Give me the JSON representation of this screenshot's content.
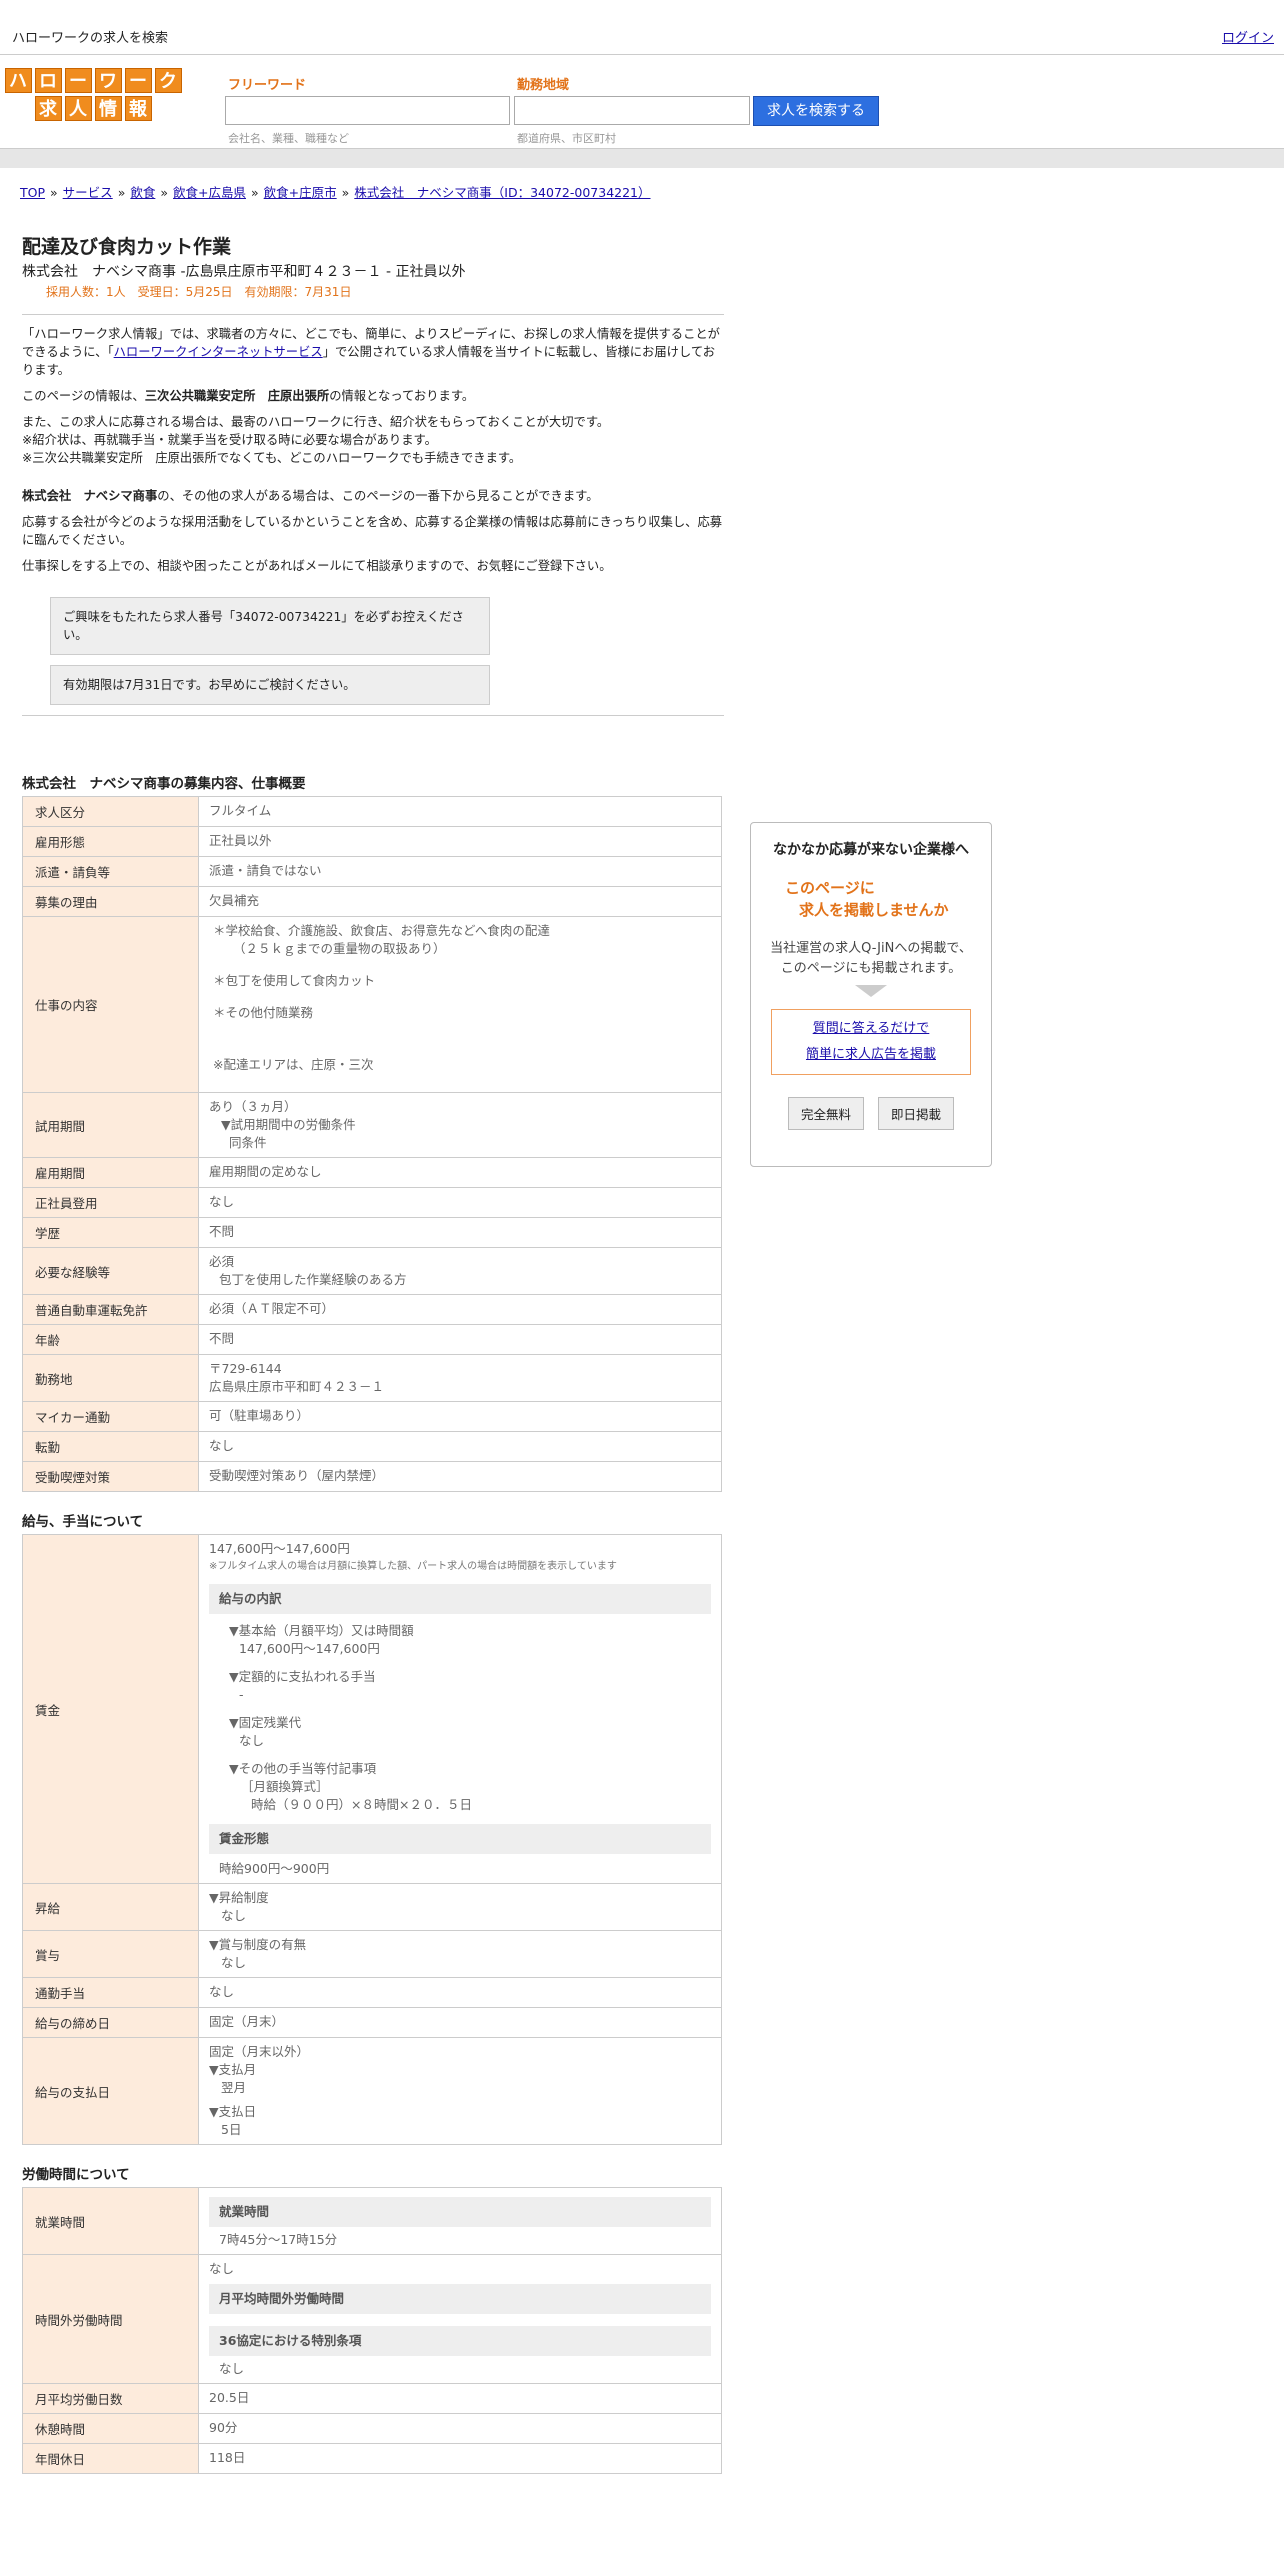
{
  "topbar": {
    "title": "ハローワークの求人を検索",
    "login": "ログイン"
  },
  "logo": {
    "row1": [
      "ハ",
      "ロ",
      "ー",
      "ワ",
      "ー",
      "ク"
    ],
    "row2": [
      "求",
      "人",
      "情",
      "報"
    ]
  },
  "search": {
    "freeword_label": "フリーワード",
    "freeword_hint": "会社名、業種、職種など",
    "area_label": "勤務地域",
    "area_hint": "都道府県、市区町村",
    "button": "求人を検索する"
  },
  "breadcrumb": [
    "TOP",
    "サービス",
    "飲食",
    "飲食+広島県",
    "飲食+庄原市",
    "株式会社　ナベシマ商事（ID：34072-00734221）"
  ],
  "job": {
    "title": "配達及び食肉カット作業",
    "subtitle": "株式会社　ナベシマ商事 -広島県庄原市平和町４２３－１ - 正社員以外",
    "meta": "採用人数：1人　受理日：5月25日　有効期限：7月31日"
  },
  "intro": {
    "p1a": "「ハローワーク求人情報」では、求職者の方々に、どこでも、簡単に、よりスピーディに、お探しの求人情報を提供することができるように、「",
    "p1link": "ハローワークインターネットサービス",
    "p1b": "」で公開されている求人情報を当サイトに転載し、皆様にお届けしております。",
    "p2a": "このページの情報は、",
    "p2b": "三次公共職業安定所　庄原出張所",
    "p2c": "の情報となっております。",
    "p3": [
      "また、この求人に応募される場合は、最寄のハローワークに行き、紹介状をもらっておくことが大切です。",
      "※紹介状は、再就職手当・就業手当を受け取る時に必要な場合があります。",
      "※三次公共職業安定所　庄原出張所でなくても、どこのハローワークでも手続きできます。"
    ],
    "p4a": "株式会社　ナベシマ商事",
    "p4b": "の、その他の求人がある場合は、このページの一番下から見ることができます。",
    "p5": "応募する会社が今どのような採用活動をしているかということを含め、応募する企業様の情報は応募前にきっちり収集し、応募に臨んでください。",
    "p6": "仕事探しをする上での、相談や困ったことがあればメールにて相談承りますので、お気軽にご登録下さい。",
    "box1": "ご興味をもたれたら求人番号「34072-00734221」を必ずお控えください。",
    "box2": "有効期限は7月31日です。お早めにご検討ください。"
  },
  "section1": {
    "title": "株式会社　ナベシマ商事の募集内容、仕事概要",
    "rows": [
      {
        "k": "求人区分",
        "v": "フルタイム"
      },
      {
        "k": "雇用形態",
        "v": "正社員以外"
      },
      {
        "k": "派遣・請負等",
        "v": "派遣・請負ではない"
      },
      {
        "k": "募集の理由",
        "v": "欠員補充"
      }
    ],
    "work_label": "仕事の内容",
    "work": [
      "＊学校給食、介護施設、飲食店、お得意先などへ食肉の配達",
      "（２５ｋｇまでの重量物の取扱あり）",
      "＊包丁を使用して食肉カット",
      "＊その他付随業務",
      "※配達エリアは、庄原・三次"
    ],
    "trial_label": "試用期間",
    "trial": [
      "あり（３ヵ月）",
      "▼試用期間中の労働条件",
      "同条件"
    ],
    "rows2": [
      {
        "k": "雇用期間",
        "v": "雇用期間の定めなし"
      },
      {
        "k": "正社員登用",
        "v": "なし"
      },
      {
        "k": "学歴",
        "v": "不問"
      }
    ],
    "exp_label": "必要な経験等",
    "exp": [
      "必須",
      "包丁を使用した作業経験のある方"
    ],
    "rows3": [
      {
        "k": "普通自動車運転免許",
        "v": "必須（ＡＴ限定不可）"
      },
      {
        "k": "年齢",
        "v": "不問"
      }
    ],
    "loc_label": "勤務地",
    "loc": [
      "〒729-6144",
      "広島県庄原市平和町４２３－１"
    ],
    "rows4": [
      {
        "k": "マイカー通勤",
        "v": "可（駐車場あり）"
      },
      {
        "k": "転勤",
        "v": "なし"
      },
      {
        "k": "受動喫煙対策",
        "v": "受動喫煙対策あり（屋内禁煙）"
      }
    ]
  },
  "section2": {
    "title": "給与、手当について",
    "wage_label": "賃金",
    "wage_main": "147,600円〜147,600円",
    "wage_note": "※フルタイム求人の場合は月額に換算した額、パート求人の場合は時間額を表示しています",
    "breakdown_head": "給与の内訳",
    "b1": [
      "▼基本給（月額平均）又は時間額",
      "147,600円〜147,600円"
    ],
    "b2": [
      "▼定額的に支払われる手当",
      "-"
    ],
    "b3": [
      "▼固定残業代",
      "なし"
    ],
    "b4": [
      "▼その他の手当等付記事項",
      "［月額換算式］",
      "時給（９００円）×８時間×２０．５日"
    ],
    "form_head": "賃金形態",
    "form_value": "時給900円〜900円",
    "raise_label": "昇給",
    "raise": [
      "▼昇給制度",
      "なし"
    ],
    "bonus_label": "賞与",
    "bonus": [
      "▼賞与制度の有無",
      "なし"
    ],
    "commute_label": "通勤手当",
    "commute": "なし",
    "cutoff_label": "給与の締め日",
    "cutoff": "固定（月末）",
    "payday_label": "給与の支払日",
    "payday": [
      "固定（月末以外）",
      "▼支払月",
      "翌月",
      "▼支払日",
      "5日"
    ]
  },
  "section3": {
    "title": "労働時間について",
    "hours_label": "就業時間",
    "hours_head": "就業時間",
    "hours": "7時45分〜17時15分",
    "overtime_label": "時間外労働時間",
    "overtime_top": "なし",
    "overtime_head1": "月平均時間外労働時間",
    "overtime_head2": "36協定における特別条項",
    "overtime_v2": "なし",
    "rows": [
      {
        "k": "月平均労働日数",
        "v": "20.5日"
      },
      {
        "k": "休憩時間",
        "v": "90分"
      },
      {
        "k": "年間休日",
        "v": "118日"
      }
    ]
  },
  "ad": {
    "heading": "なかなか応募が来ない企業様へ",
    "orange1": "このページに",
    "orange2": "求人を掲載しませんか",
    "text1": "当社運営の求人Q-JiNへの掲載で、",
    "text2": "このページにも掲載されます。",
    "link1": "質問に答えるだけで",
    "link2": "簡単に求人広告を掲載",
    "btn1": "完全無料",
    "btn2": "即日掲載"
  }
}
